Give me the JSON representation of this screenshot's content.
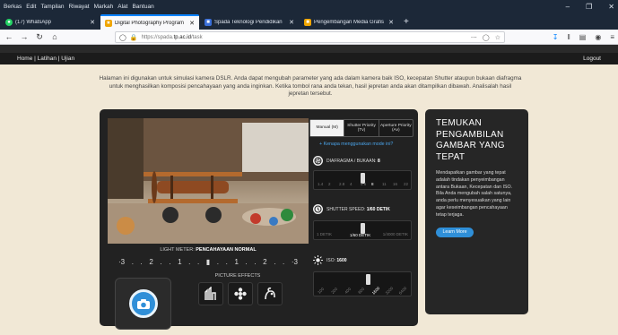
{
  "browser": {
    "menu": [
      {
        "label": "Berkas"
      },
      {
        "label": "Edit"
      },
      {
        "label": "Tampilan"
      },
      {
        "label": "Riwayat"
      },
      {
        "label": "Markah"
      },
      {
        "label": "Alat"
      },
      {
        "label": "Bantuan"
      }
    ],
    "tabs": [
      {
        "label": "(17) WhatsApp",
        "icon": "whatsapp-icon",
        "color": "#25d366"
      },
      {
        "label": "Digital Photography Program",
        "icon": "page-icon",
        "color": "#f0a500"
      },
      {
        "label": "Spada Teknologi Pendidikan",
        "icon": "spada-icon",
        "color": "#3a6fd8"
      },
      {
        "label": "Pengembangan Media Grafis",
        "icon": "document-icon",
        "color": "#f0a500"
      }
    ],
    "url_prefix": "https://spada.",
    "url_domain": "tp.ac.id",
    "url_path": "/task"
  },
  "site_nav": {
    "links": "Home | Latihan | Ujian",
    "logout": "Logout"
  },
  "intro_text": "Halaman ini digunakan untuk simulasi kamera DSLR. Anda dapat mengubah parameter yang ada dalam kamera baik ISO, kecepatan Shutter ataupun bukaan diafragma untuk menghasilkan komposisi pencahayaan yang anda inginkan. Ketika tombol rana anda tekan, hasil jepretan anda akan ditampilkan dibawah. Analisalah hasil jepretan tersebut.",
  "camera": {
    "light_meter_label": "LIGHT METER:",
    "light_meter_value": "PENCAHAYAAN NORMAL",
    "meter_scale": [
      "·3",
      ".",
      ".",
      "2",
      ".",
      ".",
      "1",
      ".",
      ".",
      "▮",
      ".",
      ".",
      "1",
      ".",
      ".",
      "2",
      ".",
      ".",
      "·3"
    ],
    "picture_effects_label": "PICTURE EFFECTS",
    "modes": [
      {
        "label": "Manual (M)",
        "active": true
      },
      {
        "label": "Shutter Priority (Tv)",
        "active": false
      },
      {
        "label": "Aperture Priority (Av)",
        "active": false
      }
    ],
    "help_link": "Kenapa menggunakan mode ini?",
    "aperture": {
      "label": "DIAFRAGMA / BUKAAN:",
      "value": "8",
      "ticks": [
        "1.4",
        "2",
        "2.8",
        "4",
        "5.6",
        "8",
        "11",
        "16",
        "22"
      ]
    },
    "shutter": {
      "label": "SHUTTER SPEED:",
      "value": "1/60 DETIK",
      "ticks": [
        "1 DETIK",
        "1/60 DETIK",
        "1/4000 DETIK"
      ]
    },
    "iso": {
      "label": "ISO:",
      "value": "1600",
      "ticks": [
        "100",
        "200",
        "400",
        "800",
        "1600",
        "3200",
        "6400"
      ]
    }
  },
  "sidebar": {
    "title": "TEMUKAN PENGAMBILAN GAMBAR YANG TEPAT",
    "body": "Mendapatkan gambar yang tepat adalah tindakan penyeimbangan antara Bukaan, Kecepatan dan ISO. Bila Anda mengubah salah satunya, anda perlu menyesuaikan yang lain agar keseimbangan pencahayaan tetap terjaga.",
    "button": "Learn More"
  },
  "colors": {
    "accent": "#2f8fd8",
    "panel": "#222222",
    "page": "#f1e8d6"
  }
}
